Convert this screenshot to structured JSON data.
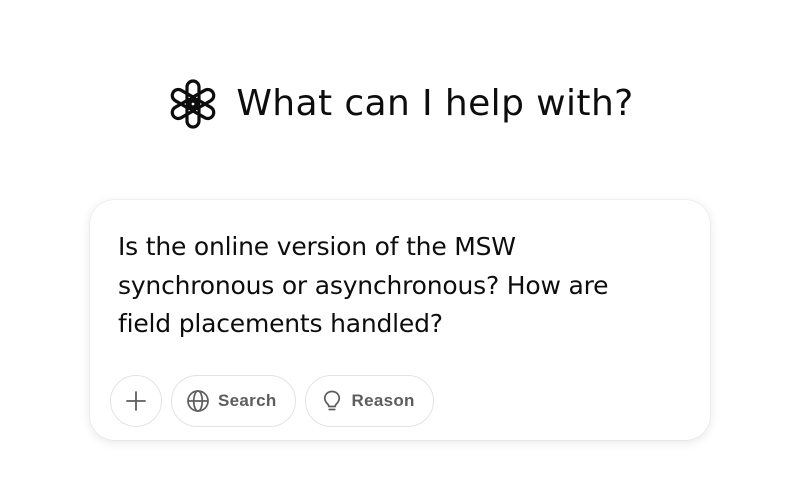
{
  "hero": {
    "headline": "What can I help with?",
    "logo_icon": "openai-logo-icon"
  },
  "composer": {
    "prompt_text": "Is the online version of the MSW synchronous or asynchronous? How are field placements handled?",
    "toolbar": {
      "attach_icon": "plus-icon",
      "search": {
        "label": "Search",
        "icon": "globe-icon"
      },
      "reason": {
        "label": "Reason",
        "icon": "lightbulb-icon"
      }
    }
  },
  "colors": {
    "background": "#ffffff",
    "text": "#0d0d0d",
    "button_label": "#5d5d5d",
    "button_border": "#e3e3e3"
  }
}
